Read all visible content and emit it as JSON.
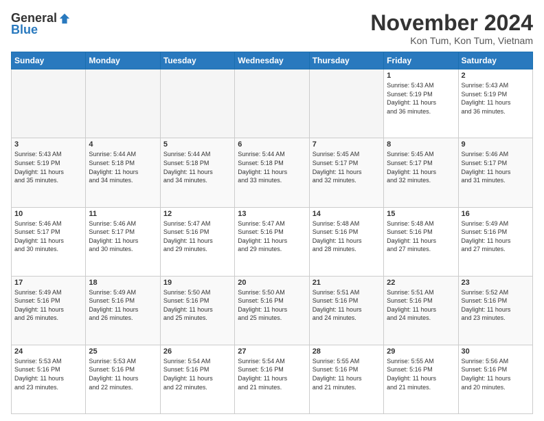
{
  "logo": {
    "general": "General",
    "blue": "Blue"
  },
  "header": {
    "month": "November 2024",
    "location": "Kon Tum, Kon Tum, Vietnam"
  },
  "weekdays": [
    "Sunday",
    "Monday",
    "Tuesday",
    "Wednesday",
    "Thursday",
    "Friday",
    "Saturday"
  ],
  "weeks": [
    [
      {
        "day": "",
        "info": ""
      },
      {
        "day": "",
        "info": ""
      },
      {
        "day": "",
        "info": ""
      },
      {
        "day": "",
        "info": ""
      },
      {
        "day": "",
        "info": ""
      },
      {
        "day": "1",
        "info": "Sunrise: 5:43 AM\nSunset: 5:19 PM\nDaylight: 11 hours\nand 36 minutes."
      },
      {
        "day": "2",
        "info": "Sunrise: 5:43 AM\nSunset: 5:19 PM\nDaylight: 11 hours\nand 36 minutes."
      }
    ],
    [
      {
        "day": "3",
        "info": "Sunrise: 5:43 AM\nSunset: 5:19 PM\nDaylight: 11 hours\nand 35 minutes."
      },
      {
        "day": "4",
        "info": "Sunrise: 5:44 AM\nSunset: 5:18 PM\nDaylight: 11 hours\nand 34 minutes."
      },
      {
        "day": "5",
        "info": "Sunrise: 5:44 AM\nSunset: 5:18 PM\nDaylight: 11 hours\nand 34 minutes."
      },
      {
        "day": "6",
        "info": "Sunrise: 5:44 AM\nSunset: 5:18 PM\nDaylight: 11 hours\nand 33 minutes."
      },
      {
        "day": "7",
        "info": "Sunrise: 5:45 AM\nSunset: 5:17 PM\nDaylight: 11 hours\nand 32 minutes."
      },
      {
        "day": "8",
        "info": "Sunrise: 5:45 AM\nSunset: 5:17 PM\nDaylight: 11 hours\nand 32 minutes."
      },
      {
        "day": "9",
        "info": "Sunrise: 5:46 AM\nSunset: 5:17 PM\nDaylight: 11 hours\nand 31 minutes."
      }
    ],
    [
      {
        "day": "10",
        "info": "Sunrise: 5:46 AM\nSunset: 5:17 PM\nDaylight: 11 hours\nand 30 minutes."
      },
      {
        "day": "11",
        "info": "Sunrise: 5:46 AM\nSunset: 5:17 PM\nDaylight: 11 hours\nand 30 minutes."
      },
      {
        "day": "12",
        "info": "Sunrise: 5:47 AM\nSunset: 5:16 PM\nDaylight: 11 hours\nand 29 minutes."
      },
      {
        "day": "13",
        "info": "Sunrise: 5:47 AM\nSunset: 5:16 PM\nDaylight: 11 hours\nand 29 minutes."
      },
      {
        "day": "14",
        "info": "Sunrise: 5:48 AM\nSunset: 5:16 PM\nDaylight: 11 hours\nand 28 minutes."
      },
      {
        "day": "15",
        "info": "Sunrise: 5:48 AM\nSunset: 5:16 PM\nDaylight: 11 hours\nand 27 minutes."
      },
      {
        "day": "16",
        "info": "Sunrise: 5:49 AM\nSunset: 5:16 PM\nDaylight: 11 hours\nand 27 minutes."
      }
    ],
    [
      {
        "day": "17",
        "info": "Sunrise: 5:49 AM\nSunset: 5:16 PM\nDaylight: 11 hours\nand 26 minutes."
      },
      {
        "day": "18",
        "info": "Sunrise: 5:49 AM\nSunset: 5:16 PM\nDaylight: 11 hours\nand 26 minutes."
      },
      {
        "day": "19",
        "info": "Sunrise: 5:50 AM\nSunset: 5:16 PM\nDaylight: 11 hours\nand 25 minutes."
      },
      {
        "day": "20",
        "info": "Sunrise: 5:50 AM\nSunset: 5:16 PM\nDaylight: 11 hours\nand 25 minutes."
      },
      {
        "day": "21",
        "info": "Sunrise: 5:51 AM\nSunset: 5:16 PM\nDaylight: 11 hours\nand 24 minutes."
      },
      {
        "day": "22",
        "info": "Sunrise: 5:51 AM\nSunset: 5:16 PM\nDaylight: 11 hours\nand 24 minutes."
      },
      {
        "day": "23",
        "info": "Sunrise: 5:52 AM\nSunset: 5:16 PM\nDaylight: 11 hours\nand 23 minutes."
      }
    ],
    [
      {
        "day": "24",
        "info": "Sunrise: 5:53 AM\nSunset: 5:16 PM\nDaylight: 11 hours\nand 23 minutes."
      },
      {
        "day": "25",
        "info": "Sunrise: 5:53 AM\nSunset: 5:16 PM\nDaylight: 11 hours\nand 22 minutes."
      },
      {
        "day": "26",
        "info": "Sunrise: 5:54 AM\nSunset: 5:16 PM\nDaylight: 11 hours\nand 22 minutes."
      },
      {
        "day": "27",
        "info": "Sunrise: 5:54 AM\nSunset: 5:16 PM\nDaylight: 11 hours\nand 21 minutes."
      },
      {
        "day": "28",
        "info": "Sunrise: 5:55 AM\nSunset: 5:16 PM\nDaylight: 11 hours\nand 21 minutes."
      },
      {
        "day": "29",
        "info": "Sunrise: 5:55 AM\nSunset: 5:16 PM\nDaylight: 11 hours\nand 21 minutes."
      },
      {
        "day": "30",
        "info": "Sunrise: 5:56 AM\nSunset: 5:16 PM\nDaylight: 11 hours\nand 20 minutes."
      }
    ]
  ]
}
